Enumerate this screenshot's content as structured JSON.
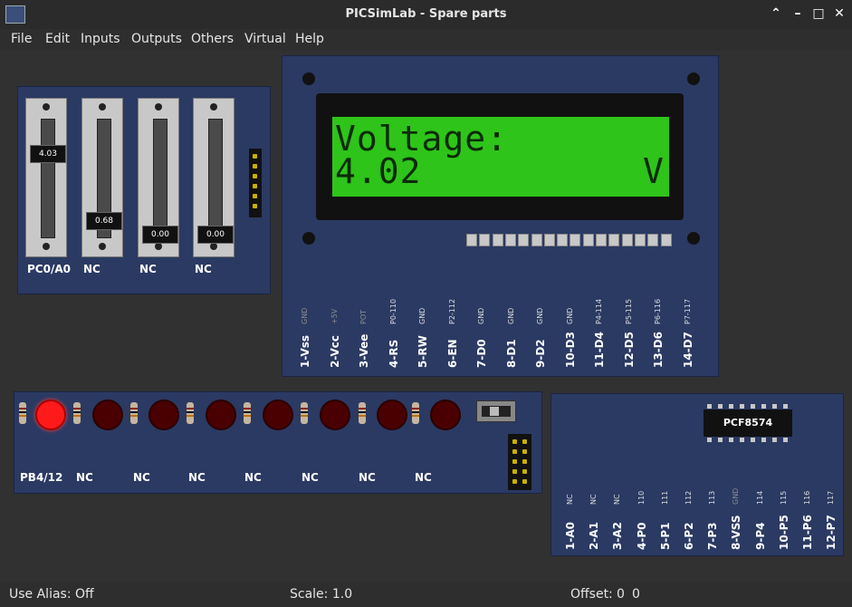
{
  "window": {
    "title": "PICSimLab - Spare parts"
  },
  "menu": [
    "File",
    "Edit",
    "Inputs",
    "Outputs",
    "Others",
    "Virtual",
    "Help"
  ],
  "potentiometers": {
    "values": [
      "4.03",
      "0.68",
      "0.00",
      "0.00"
    ],
    "levels": [
      0.81,
      0.14,
      0.0,
      0.0
    ],
    "labels": [
      "PC0/A0",
      "NC",
      "NC",
      "NC"
    ]
  },
  "lcd": {
    "line1": "Voltage:",
    "line2_left": "4.02",
    "line2_right": "V",
    "pin_labels": [
      "1-Vss",
      "2-Vcc",
      "3-Vee",
      "4-RS",
      "5-RW",
      "6-EN",
      "7-D0",
      "8-D1",
      "9-D2",
      "10-D3",
      "11-D4",
      "12-D5",
      "13-D6",
      "14-D7"
    ],
    "pin_subs": [
      "GND",
      "+5V",
      "POT",
      "P0-110",
      "GND",
      "P2-112",
      "GND",
      "GND",
      "GND",
      "GND",
      "P4-114",
      "P5-115",
      "P6-116",
      "P7-117"
    ]
  },
  "leds": {
    "labels": [
      "PB4/12",
      "NC",
      "NC",
      "NC",
      "NC",
      "NC",
      "NC",
      "NC"
    ],
    "states": [
      true,
      false,
      false,
      false,
      false,
      false,
      false,
      false
    ]
  },
  "io_expander": {
    "chip": "PCF8574",
    "pin_labels": [
      "1-A0",
      "2-A1",
      "3-A2",
      "4-P0",
      "5-P1",
      "6-P2",
      "7-P3",
      "8-VSS",
      "9-P4",
      "10-P5",
      "11-P6",
      "12-P7"
    ],
    "pin_subs": [
      "NC",
      "NC",
      "NC",
      "110",
      "111",
      "112",
      "113",
      "GND",
      "114",
      "115",
      "116",
      "117"
    ]
  },
  "status": {
    "alias": "Use Alias: Off",
    "scale": "Scale: 1.0",
    "offset_label": "Offset:",
    "offset_x": "0",
    "offset_y": "0"
  },
  "colors": {
    "board": "#2b3a63",
    "lcd_screen": "#2ec41a",
    "led_on": "#ff1a1a"
  }
}
